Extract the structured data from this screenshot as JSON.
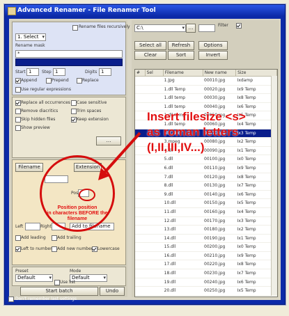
{
  "window": {
    "title": "Advanced Renamer - File Renamer Tool"
  },
  "left": {
    "top_checkbox_label": "Rename files recursively",
    "combo_value": "1. Select",
    "mask_label": "Rename mask",
    "input_value": "*",
    "dark_field": "",
    "num_label": "Start",
    "step_label": "Step",
    "digits_label": "Digits",
    "num_value": "1",
    "step_value": "1",
    "digits_value": "1",
    "radio_labels": [
      "Append",
      "Prepend",
      "Replace"
    ],
    "options": [
      "Replace all occurrences",
      "Case sensitive",
      "Remove diacritics",
      "Trim spaces",
      "Use regular expressions",
      "Skip hidden files",
      "Keep extension",
      "Show preview"
    ],
    "tabs": [
      "Filename",
      "Insert",
      "Extension"
    ],
    "insert_field_value": "",
    "position_label": "Pos",
    "annotation_position_line1": "Position position",
    "annotation_position_line2": "in characters BEFORE the filename",
    "bottom_fields": [
      "Left",
      "Right"
    ],
    "bottom_text": "Add to filename",
    "checkboxes_bottom": [
      "Add leading",
      "Add trailing"
    ],
    "checkboxes_bottom2": [
      "Left to number",
      "Add new number",
      "Lowercase"
    ],
    "preset_label": "Preset",
    "preset_value": "Default",
    "mode_label": "Mode",
    "mode_value": "Default",
    "use_list_label": "Use list",
    "start_button": "Start batch",
    "undo_button": "Undo",
    "status_checkbox": "Don't remember last settings"
  },
  "right": {
    "folder_value": "C:\\",
    "filter_label": "Filter",
    "buttons_row1": [
      "Select all",
      "Refresh",
      "Options"
    ],
    "buttons_row2": [
      "Clear",
      "Sort",
      "Invert"
    ],
    "columns": [
      "#",
      "Sel",
      "Filename",
      "New name",
      "Size"
    ],
    "rows": [
      [
        "",
        "",
        "1.Jpg",
        "00010.jpg",
        "Ixdamp"
      ],
      [
        "",
        "",
        "1.dll Temp",
        "00020.jpg",
        "Ix9 Temp"
      ],
      [
        "",
        "",
        "1.dll temp",
        "00030.jpg",
        "Ix8 Temp"
      ],
      [
        "",
        "",
        "1.dll temp",
        "00040.jpg",
        "Ix6 Temp"
      ],
      [
        "",
        "",
        "1.dll temp",
        "00050.jpg",
        "Ix5 Temp"
      ],
      [
        "",
        "",
        "1.dll temp",
        "00060.jpg",
        "Ix4 Temp"
      ],
      [
        "",
        "",
        "abc.doc",
        "00070.jpg",
        "Ix3 Temp"
      ],
      [
        "",
        "",
        "3.mpeg",
        "00080.jpg",
        "Ix2 Temp"
      ],
      [
        "",
        "",
        "4.dll",
        "00090.jpg",
        "Ix1 Temp"
      ],
      [
        "",
        "",
        "5.dll",
        "00100.jpg",
        "Ix0 Temp"
      ],
      [
        "",
        "",
        "6.dll",
        "00110.jpg",
        "Ix9 Temp"
      ],
      [
        "",
        "",
        "7.dll",
        "00120.jpg",
        "Ix8 Temp"
      ],
      [
        "",
        "",
        "8.dll",
        "00130.jpg",
        "Ix7 Temp"
      ],
      [
        "",
        "",
        "9.dll",
        "00140.jpg",
        "Ix6 Temp"
      ],
      [
        "",
        "",
        "10.dll",
        "00150.jpg",
        "Ix5 Temp"
      ],
      [
        "",
        "",
        "11.dll",
        "00160.jpg",
        "Ix4 Temp"
      ],
      [
        "",
        "",
        "12.dll",
        "00170.jpg",
        "Ix3 Temp"
      ],
      [
        "",
        "",
        "13.dll",
        "00180.jpg",
        "Ix2 Temp"
      ],
      [
        "",
        "",
        "14.dll",
        "00190.jpg",
        "Ix1 Temp"
      ],
      [
        "",
        "",
        "15.dll",
        "00200.jpg",
        "Ix0 Temp"
      ],
      [
        "",
        "",
        "16.dll",
        "00210.jpg",
        "Ix9 Temp"
      ],
      [
        "",
        "",
        "17.dll",
        "00220.jpg",
        "Ix8 Temp"
      ],
      [
        "",
        "",
        "18.dll",
        "00230.jpg",
        "Ix7 Temp"
      ],
      [
        "",
        "",
        "19.dll",
        "00240.jpg",
        "Ix6 Temp"
      ],
      [
        "",
        "",
        "20.dll",
        "00250.jpg",
        "Ix5 Temp"
      ],
      [
        "",
        "",
        "21.dll",
        "00260.jpg",
        "Ix4 Temp"
      ],
      [
        "",
        "",
        "22.dll",
        "00270.jpg",
        "Ix3 Temp"
      ]
    ],
    "selected_row_index": 6
  },
  "annotation": {
    "line1": "Insert filesize <s>",
    "line2": "as roman letters",
    "line3": "(I,II,III,IV...)"
  },
  "colors": {
    "title_blue": "#0c2aa8",
    "annotation_red": "#e20f0f",
    "selection_blue": "#0a1e8c"
  }
}
